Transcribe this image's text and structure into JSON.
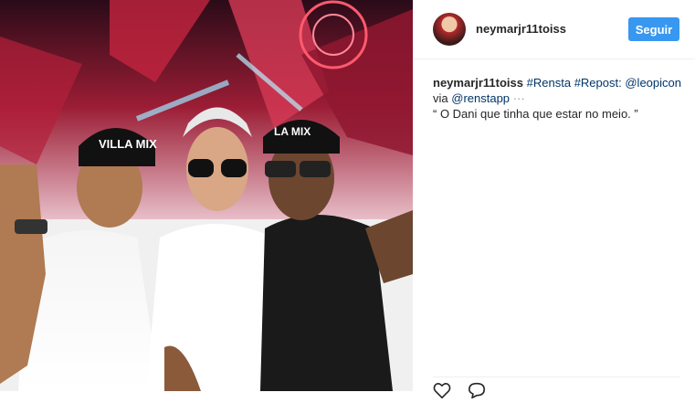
{
  "post": {
    "username": "neymarjr11toiss",
    "follow_label": "Seguir"
  },
  "caption": {
    "username": "neymarjr11toiss",
    "tags": [
      "#Rensta",
      "#Repost:",
      "@leopicon"
    ],
    "via_text": "via",
    "via_handle": "@renstapp",
    "ellipsis": "···",
    "quote": "“ O Dani que tinha que estar no meio. ”"
  },
  "photo": {
    "cap_text_left": "VILLA MIX",
    "cap_text_right": "LA MIX"
  },
  "icons": {
    "like": "heart-icon",
    "comment": "comment-icon"
  }
}
